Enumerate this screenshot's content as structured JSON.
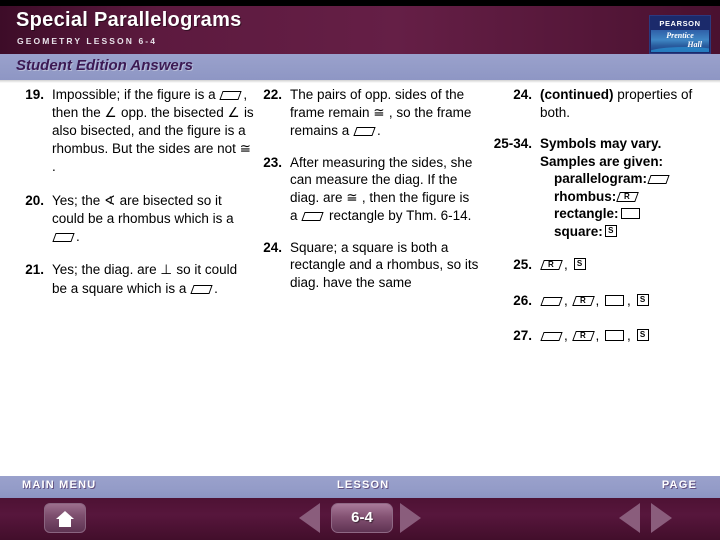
{
  "header": {
    "title": "Special Parallelograms",
    "subtitle": "GEOMETRY LESSON 6-4",
    "logo": {
      "top": "PEARSON",
      "line1": "Prentice",
      "line2": "Hall"
    },
    "band_label": "Student Edition Answers",
    "colors": {
      "maroon": "#5d1a3f",
      "periwinkle": "#949cc8",
      "band_text": "#3c1a54"
    }
  },
  "answers": {
    "col1": [
      {
        "number": "19.",
        "parts": [
          {
            "t": "text",
            "v": "Impossible; if the figure is a "
          },
          {
            "t": "sym",
            "v": "parallelogram"
          },
          {
            "t": "text",
            "v": ", then the "
          },
          {
            "t": "sym",
            "v": "angle"
          },
          {
            "t": "text",
            "v": " opp. the bisected "
          },
          {
            "t": "sym",
            "v": "angle"
          },
          {
            "t": "text",
            "v": " is also bisected, and the figure is a rhombus. But the sides are not "
          },
          {
            "t": "sym",
            "v": "congruent"
          },
          {
            "t": "text",
            "v": "."
          }
        ]
      },
      {
        "number": "20.",
        "parts": [
          {
            "t": "text",
            "v": "Yes; the "
          },
          {
            "t": "sym",
            "v": "angles"
          },
          {
            "t": "text",
            "v": " are bisected so it could be a rhombus which is a "
          },
          {
            "t": "sym",
            "v": "parallelogram"
          },
          {
            "t": "text",
            "v": "."
          }
        ]
      },
      {
        "number": "21.",
        "parts": [
          {
            "t": "text",
            "v": "Yes; the diag. are "
          },
          {
            "t": "sym",
            "v": "perpendicular"
          },
          {
            "t": "text",
            "v": " so it could be a square which is a "
          },
          {
            "t": "sym",
            "v": "parallelogram"
          },
          {
            "t": "text",
            "v": "."
          }
        ]
      }
    ],
    "col2": [
      {
        "number": "22.",
        "parts": [
          {
            "t": "text",
            "v": "The pairs of opp. sides of the frame remain "
          },
          {
            "t": "sym",
            "v": "congruent"
          },
          {
            "t": "text",
            "v": ", so the frame remains a "
          },
          {
            "t": "sym",
            "v": "parallelogram"
          },
          {
            "t": "text",
            "v": "."
          }
        ]
      },
      {
        "number": "23.",
        "parts": [
          {
            "t": "text",
            "v": "After measuring the sides, she can measure the diag. If the diag. are "
          },
          {
            "t": "sym",
            "v": "congruent"
          },
          {
            "t": "text",
            "v": ", then the figure is a "
          },
          {
            "t": "sym",
            "v": "parallelogram"
          },
          {
            "t": "text",
            "v": " rectangle by Thm. 6-14."
          }
        ]
      },
      {
        "number": "24.",
        "parts": [
          {
            "t": "text",
            "v": "Square; a square is both a rectangle and a rhombus, so its diag. have the same"
          }
        ]
      }
    ],
    "col3": [
      {
        "number": "24.",
        "bold_lead": "(continued)",
        "parts": [
          {
            "t": "text",
            "v": "properties of both."
          }
        ]
      },
      {
        "number": "25-34.",
        "bold": true,
        "parts": [
          {
            "t": "text",
            "v": "Symbols may vary. Samples are given:"
          }
        ],
        "symbol_key": [
          {
            "label": "parallelogram:",
            "sym": "parallelogram"
          },
          {
            "label": "rhombus:",
            "sym": "rhombus"
          },
          {
            "label": "rectangle:",
            "sym": "rectangle"
          },
          {
            "label": "square:",
            "sym": "square"
          }
        ]
      },
      {
        "number": "25.",
        "symbols": [
          "rhombus",
          "square"
        ]
      },
      {
        "number": "26.",
        "symbols": [
          "parallelogram",
          "rhombus",
          "rectangle",
          "square"
        ]
      },
      {
        "number": "27.",
        "symbols": [
          "parallelogram",
          "rhombus",
          "rectangle",
          "square"
        ]
      }
    ]
  },
  "symbol_glyphs": {
    "angle": "∠",
    "angles": "∢",
    "congruent": "≅",
    "perpendicular": "⊥",
    "rhombus_letter": "R",
    "square_letter": "S"
  },
  "footer": {
    "main_menu_label": "MAIN MENU",
    "lesson_label": "LESSON",
    "page_label": "PAGE",
    "lesson_number": "6-4",
    "home_icon": "home-icon",
    "prev_icon": "triangle-left-icon",
    "next_icon": "triangle-right-icon"
  }
}
